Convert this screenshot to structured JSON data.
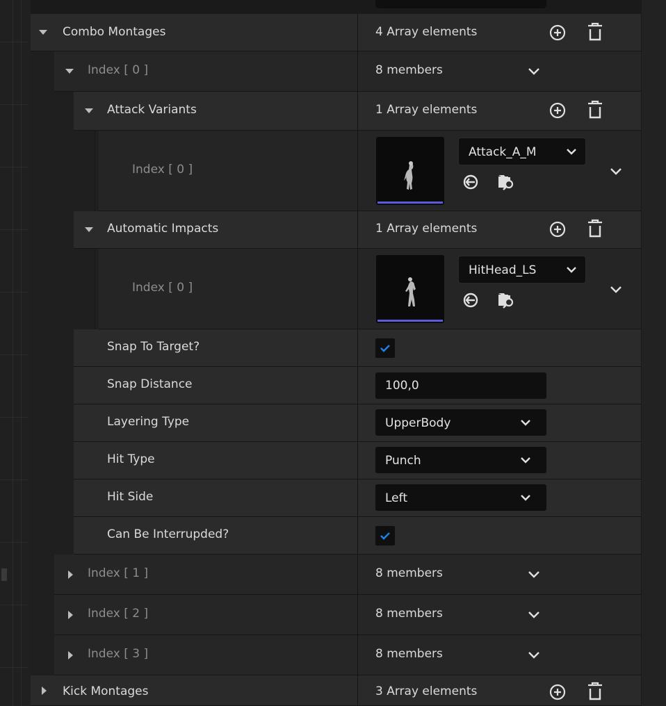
{
  "rows": {
    "combo_montages": {
      "label": "Combo Montages",
      "value": "4 Array elements"
    },
    "index0": {
      "label": "Index [ 0 ]",
      "value": "8 members"
    },
    "attack_variants": {
      "label": "Attack Variants",
      "value": "1 Array elements"
    },
    "attack_index0": {
      "label": "Index [ 0 ]",
      "asset": "Attack_A_M"
    },
    "automatic_impacts": {
      "label": "Automatic Impacts",
      "value": "1 Array elements"
    },
    "impacts_index0": {
      "label": "Index [ 0 ]",
      "asset": "HitHead_LS"
    },
    "snap_to_target": {
      "label": "Snap To Target?",
      "checked": true
    },
    "snap_distance": {
      "label": "Snap Distance",
      "value": "100,0"
    },
    "layering_type": {
      "label": "Layering Type",
      "value": "UpperBody"
    },
    "hit_type": {
      "label": "Hit Type",
      "value": "Punch"
    },
    "hit_side": {
      "label": "Hit Side",
      "value": "Left"
    },
    "can_be_interrupted": {
      "label": "Can Be Interrupded?",
      "checked": true
    },
    "index1": {
      "label": "Index [ 1 ]",
      "value": "8 members"
    },
    "index2": {
      "label": "Index [ 2 ]",
      "value": "8 members"
    },
    "index3": {
      "label": "Index [ 3 ]",
      "value": "8 members"
    },
    "kick_montages": {
      "label": "Kick Montages",
      "value": "3 Array elements"
    }
  },
  "colors": {
    "accent_check": "#1f7fe0",
    "thumb_bar": "#5b5bdc",
    "panel": "#2a2a2a"
  },
  "icons": [
    "add-element-icon",
    "delete-all-icon",
    "chevron-down-icon",
    "use-selected-asset-icon",
    "browse-asset-icon",
    "expand-arrow-icon",
    "collapse-arrow-icon"
  ]
}
